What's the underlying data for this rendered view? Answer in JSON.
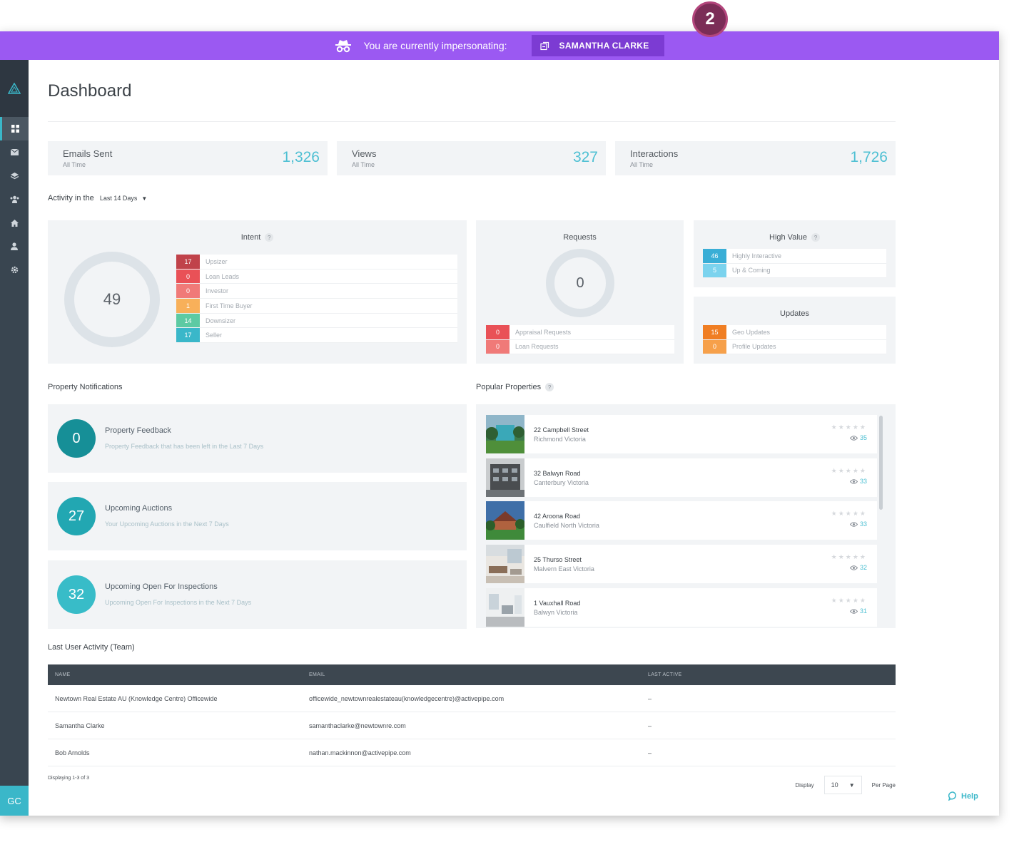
{
  "step_badge": "2",
  "impersonation": {
    "message": "You are currently impersonating:",
    "user": "SAMANTHA CLARKE",
    "bar_color": "#9b59f2"
  },
  "sidebar": {
    "items": [
      {
        "icon": "grid-icon",
        "active": true
      },
      {
        "icon": "envelope-icon",
        "active": false
      },
      {
        "icon": "layers-icon",
        "active": false
      },
      {
        "icon": "users-group-icon",
        "active": false
      },
      {
        "icon": "home-icon",
        "active": false
      },
      {
        "icon": "person-icon",
        "active": false
      },
      {
        "icon": "gear-icon",
        "active": false
      }
    ],
    "avatar": "GC"
  },
  "page": {
    "title": "Dashboard"
  },
  "stats": [
    {
      "label": "Emails Sent",
      "sub": "All Time",
      "value": "1,326"
    },
    {
      "label": "Views",
      "sub": "All Time",
      "value": "327"
    },
    {
      "label": "Interactions",
      "sub": "All Time",
      "value": "1,726"
    }
  ],
  "activity": {
    "prefix": "Activity in the",
    "range": "Last 14 Days"
  },
  "intent": {
    "title": "Intent",
    "help": "?",
    "total": "49",
    "rows": [
      {
        "value": "17",
        "label": "Upsizer",
        "color": "#c0424a"
      },
      {
        "value": "0",
        "label": "Loan Leads",
        "color": "#e95157"
      },
      {
        "value": "0",
        "label": "Investor",
        "color": "#f07a78"
      },
      {
        "value": "1",
        "label": "First Time Buyer",
        "color": "#f8b05a"
      },
      {
        "value": "14",
        "label": "Downsizer",
        "color": "#5dcaa3"
      },
      {
        "value": "17",
        "label": "Seller",
        "color": "#3ab7c9"
      }
    ]
  },
  "requests": {
    "title": "Requests",
    "total": "0",
    "rows": [
      {
        "value": "0",
        "label": "Appraisal Requests",
        "color": "#e95157"
      },
      {
        "value": "0",
        "label": "Loan Requests",
        "color": "#f07a78"
      }
    ]
  },
  "high_value": {
    "title": "High Value",
    "help": "?",
    "rows": [
      {
        "value": "46",
        "label": "Highly Interactive",
        "color": "#3aaed6"
      },
      {
        "value": "5",
        "label": "Up & Coming",
        "color": "#7bd3ee"
      }
    ]
  },
  "updates": {
    "title": "Updates",
    "rows": [
      {
        "value": "15",
        "label": "Geo Updates",
        "color": "#f07e23"
      },
      {
        "value": "0",
        "label": "Profile Updates",
        "color": "#f6a04a"
      }
    ]
  },
  "property_notifications": {
    "title": "Property Notifications",
    "items": [
      {
        "count": "0",
        "title": "Property Feedback",
        "sub": "Property Feedback that has been left in the Last 7 Days",
        "color": "#168f97"
      },
      {
        "count": "27",
        "title": "Upcoming Auctions",
        "sub": "Your Upcoming Auctions in the Next 7 Days",
        "color": "#22a7b2"
      },
      {
        "count": "32",
        "title": "Upcoming Open For Inspections",
        "sub": "Upcoming Open For Inspections in the Next 7 Days",
        "color": "#38bcc8"
      }
    ]
  },
  "popular_properties": {
    "title": "Popular Properties",
    "help": "?",
    "items": [
      {
        "address": "22 Campbell Street",
        "suburb": "Richmond Victoria",
        "views": "35",
        "stars": "★★★★★"
      },
      {
        "address": "32 Balwyn Road",
        "suburb": "Canterbury Victoria",
        "views": "33",
        "stars": "★★★★★"
      },
      {
        "address": "42 Aroona Road",
        "suburb": "Caulfield North Victoria",
        "views": "33",
        "stars": "★★★★★"
      },
      {
        "address": "25 Thurso Street",
        "suburb": "Malvern East Victoria",
        "views": "32",
        "stars": "★★★★★"
      },
      {
        "address": "1 Vauxhall Road",
        "suburb": "Balwyn Victoria",
        "views": "31",
        "stars": "★★★★★"
      }
    ]
  },
  "user_activity": {
    "title": "Last User Activity (Team)",
    "columns": [
      "NAME",
      "EMAIL",
      "LAST ACTIVE"
    ],
    "rows": [
      {
        "name": "Newtown Real Estate AU (Knowledge Centre) Officewide",
        "email": "officewide_newtownrealestateau(knowledgecentre)@activepipe.com",
        "last": "–"
      },
      {
        "name": "Samantha Clarke",
        "email": "samanthaclarke@newtownre.com",
        "last": "–"
      },
      {
        "name": "Bob Arnolds",
        "email": "nathan.mackinnon@activepipe.com",
        "last": "–"
      }
    ],
    "displaying": "Displaying 1-3 of 3",
    "display_label": "Display",
    "per_page": "10",
    "per_page_label": "Per Page"
  },
  "help": {
    "label": "Help"
  }
}
